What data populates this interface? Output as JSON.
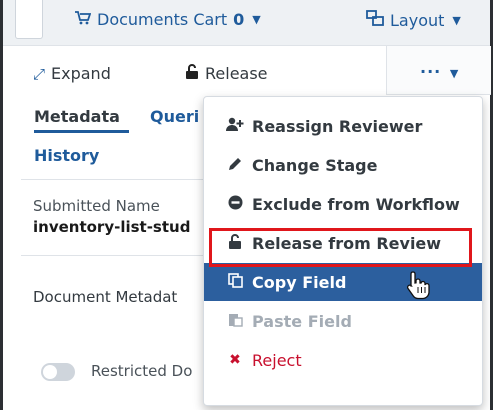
{
  "topbar": {
    "cart_label": "Documents Cart",
    "cart_count": "0",
    "layout_label": "Layout"
  },
  "toolbar": {
    "expand_label": "Expand",
    "release_label": "Release",
    "more_label": "···"
  },
  "tabs": {
    "metadata": "Metadata",
    "queries": "Queri",
    "history": "History"
  },
  "document": {
    "submitted_name_label": "Submitted Name",
    "submitted_name_value": "inventory-list-stud",
    "metadata_label": "Document Metadat",
    "restricted_label": "Restricted Do"
  },
  "menu": {
    "items": [
      {
        "label": "Reassign Reviewer",
        "icon": "user-plus-icon"
      },
      {
        "label": "Change Stage",
        "icon": "pencil-icon"
      },
      {
        "label": "Exclude from Workflow",
        "icon": "minus-circle-icon"
      },
      {
        "label": "Release from Review",
        "icon": "unlock-icon"
      },
      {
        "label": "Copy Field",
        "icon": "copy-icon"
      },
      {
        "label": "Paste Field",
        "icon": "paste-icon"
      },
      {
        "label": "Reject",
        "icon": "x-icon"
      }
    ]
  },
  "colors": {
    "accent": "#1f5b9b",
    "highlight": "#2c5f9e",
    "annotation_red": "#e0161b",
    "reject_red": "#c8102e"
  }
}
